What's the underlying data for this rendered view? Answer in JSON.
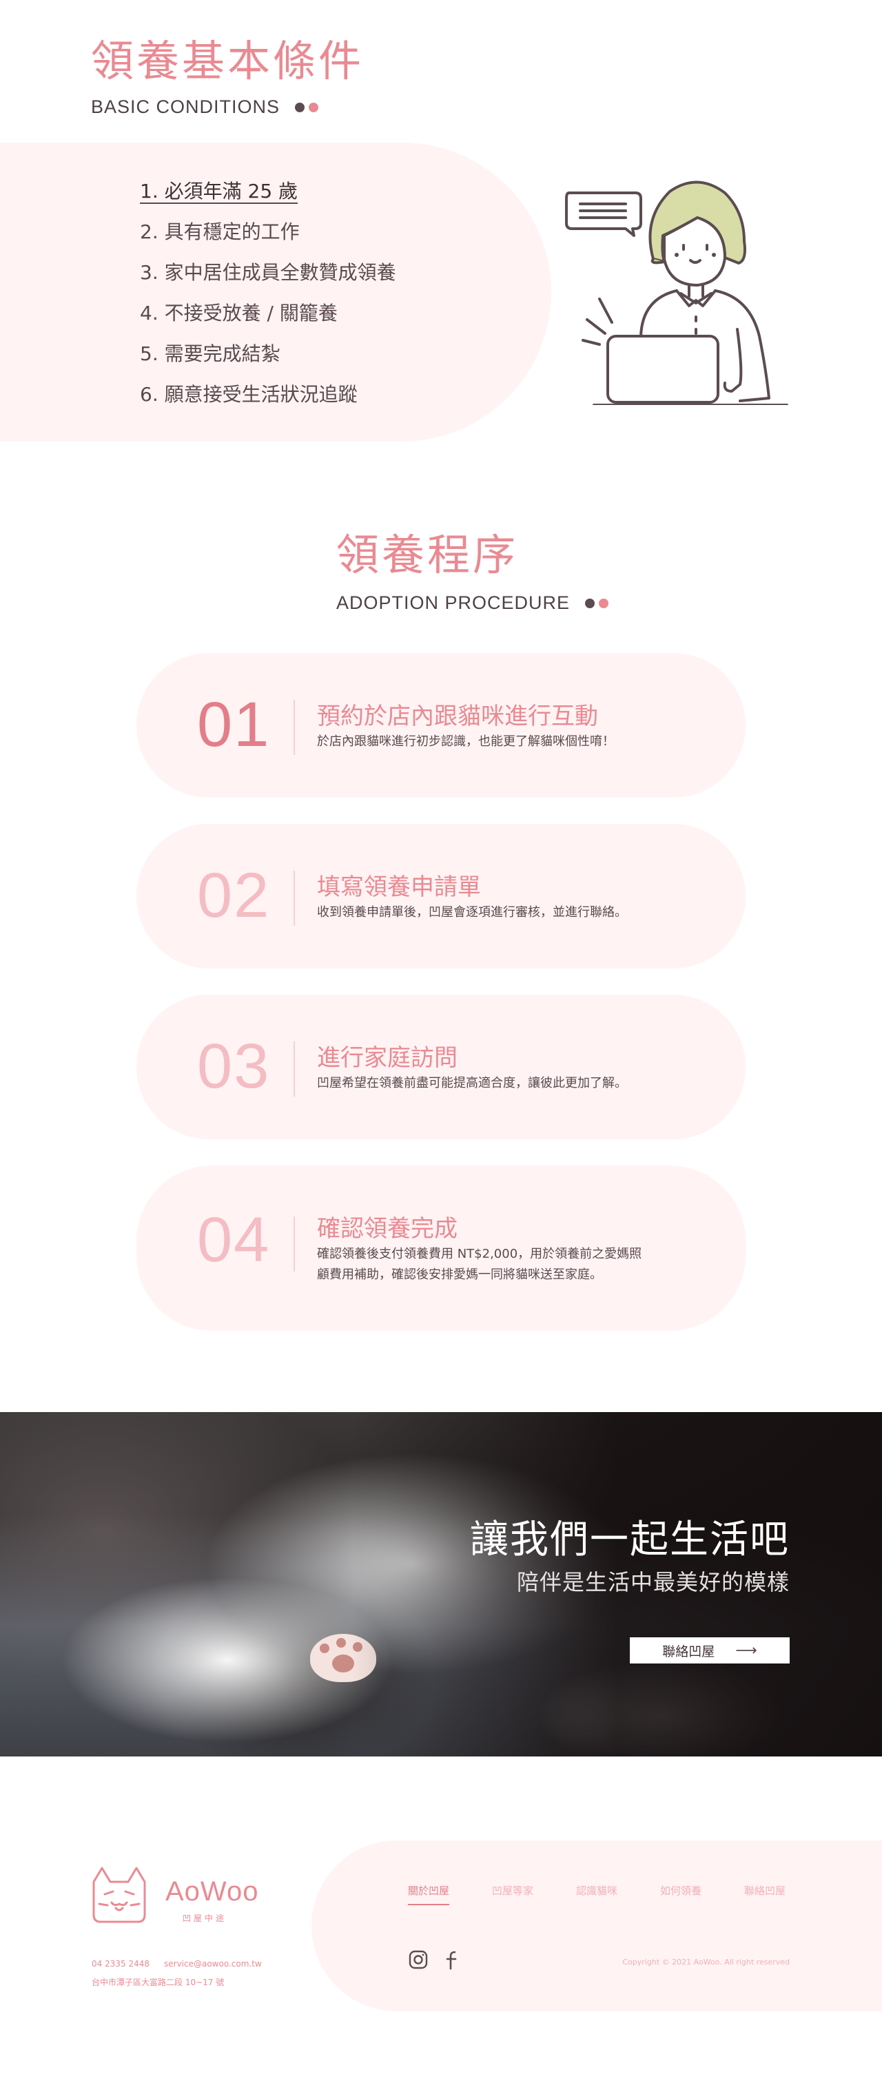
{
  "conditions": {
    "title": "領養基本條件",
    "subtitle": "BASIC CONDITIONS",
    "items": [
      "1. 必須年滿 25 歲",
      "2. 具有穩定的工作",
      "3. 家中居住成員全數贊成領養",
      "4. 不接受放養 / 關籠養",
      "5. 需要完成結紮",
      "6. 願意接受生活狀況追蹤"
    ]
  },
  "procedure": {
    "title": "領養程序",
    "subtitle": "ADOPTION PROCEDURE",
    "steps": [
      {
        "num": "01",
        "title": "預約於店內跟貓咪進行互動",
        "desc": "於店內跟貓咪進行初步認識，也能更了解貓咪個性唷！"
      },
      {
        "num": "02",
        "title": "填寫領養申請單",
        "desc": "收到領養申請單後，凹屋會逐項進行審核，並進行聯絡。"
      },
      {
        "num": "03",
        "title": "進行家庭訪問",
        "desc": "凹屋希望在領養前盡可能提高適合度，讓彼此更加了解。"
      },
      {
        "num": "04",
        "title": "確認領養完成",
        "desc": "確認領養後支付領養費用 NT$2,000，用於領養前之愛媽照顧費用補助，確認後安排愛媽一同將貓咪送至家庭。"
      }
    ]
  },
  "banner": {
    "title": "讓我們一起生活吧",
    "subtitle": "陪伴是生活中最美好的模樣",
    "button_label": "聯絡凹屋",
    "button_icon": "arrow-right-icon"
  },
  "footer": {
    "logo_text": "AoWoo",
    "logo_tag": "凹屋中途",
    "phone": "04 2335 2448",
    "email": "service@aowoo.com.tw",
    "address": "台中市潭子區大富路二段 10~17 號",
    "nav": [
      "關於凹屋",
      "凹屋等家",
      "認識貓咪",
      "如何領養",
      "聯絡凹屋"
    ],
    "social": [
      "instagram-icon",
      "facebook-icon"
    ],
    "copyright": "Copyright © 2021 AoWoo. All right reserved"
  },
  "colors": {
    "accent": "#e98a92",
    "accent_dark": "#e37e89",
    "soft_bg": "#fff3f4",
    "text": "#5a4a4e"
  }
}
